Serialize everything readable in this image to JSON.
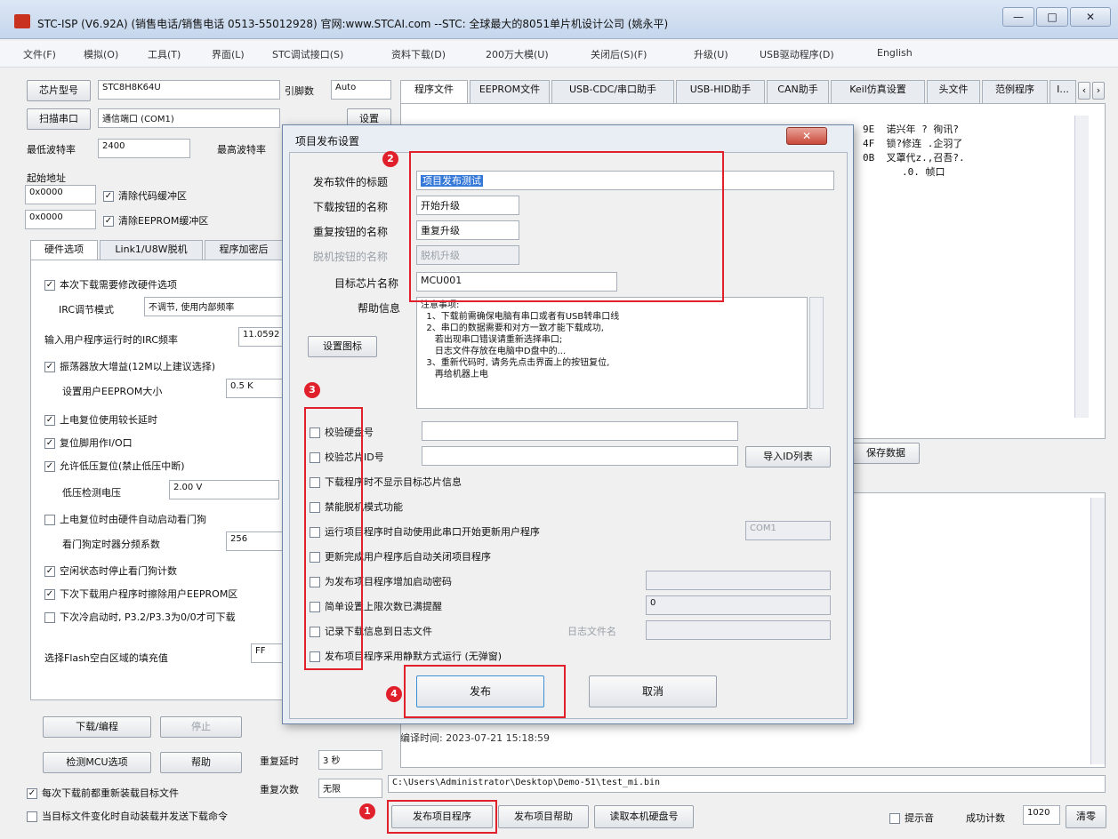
{
  "window": {
    "title": "STC-ISP (V6.92A) (销售电话/销售电话 0513-55012928) 官网:www.STCAI.com  --STC: 全球最大的8051单片机设计公司 (姚永平)",
    "min": "—",
    "max": "□",
    "close": "✕"
  },
  "menu": [
    "文件(F)",
    "模拟(O)",
    "工具(T)",
    "界面(L)",
    "STC调试接口(S)",
    "资料下载(D)",
    "200万大模(U)",
    "关闭后(S)(F)",
    "升级(U)",
    "USB驱动程序(D)",
    "English"
  ],
  "left": {
    "chip_label": "芯片型号",
    "chip_value": "STC8H8K64U",
    "pins_label": "引脚数",
    "pins_value": "Auto",
    "scan_btn": "扫描串口",
    "port_value": "通信端口 (COM1)",
    "settings_btn": "设置",
    "min_baud_label": "最低波特率",
    "min_baud_value": "2400",
    "max_baud_label": "最高波特率",
    "start_addr_label": "起始地址",
    "addr1": "0x0000",
    "clear_code": "清除代码缓冲区",
    "addr2": "0x0000",
    "clear_eeprom": "清除EEPROM缓冲区",
    "tabs": [
      "硬件选项",
      "Link1/U8W脱机",
      "程序加密后"
    ],
    "opts": {
      "o1": "本次下载需要修改硬件选项",
      "irc_label": "IRC调节模式",
      "irc_value": "不调节, 使用内部频率",
      "freq_label": "输入用户程序运行时的IRC频率",
      "freq_value": "11.0592",
      "o2": "振荡器放大增益(12M以上建议选择)",
      "eeprom_size_label": "设置用户EEPROM大小",
      "eeprom_size_value": "0.5 K",
      "o3": "上电复位使用较长延时",
      "o4": "复位脚用作I/O口",
      "o5": "允许低压复位(禁止低压中断)",
      "lv_label": "低压检测电压",
      "lv_value": "2.00 V",
      "o6": "上电复位时由硬件自动启动看门狗",
      "wdt_label": "看门狗定时器分频系数",
      "wdt_value": "256",
      "o7": "空闲状态时停止看门狗计数",
      "o8": "下次下载用户程序时擦除用户EEPROM区",
      "o9": "下次冷启动时, P3.2/P3.3为0/0才可下载",
      "fill_label": "选择Flash空白区域的填充值",
      "fill_value": "FF"
    },
    "download_btn": "下载/编程",
    "stop_btn": "停止",
    "check_mcu_btn": "检测MCU选项",
    "help_btn": "帮助",
    "retry_delay_label": "重复延时",
    "retry_delay_value": "3 秒",
    "retry_count_label": "重复次数",
    "retry_count_value": "无限",
    "reload_each": "每次下载前都重新装载目标文件",
    "auto_send": "当目标文件变化时自动装载并发送下载命令"
  },
  "right": {
    "tabs": [
      "程序文件",
      "EEPROM文件",
      "USB-CDC/串口助手",
      "USB-HID助手",
      "CAN助手",
      "Keil仿真设置",
      "头文件",
      "范例程序",
      "I..."
    ],
    "hex": [
      {
        "addr": "9E",
        "text": "诺兴年 ?  徇讯?"
      },
      {
        "addr": "4F",
        "text": "锁?修连  .企羽了"
      },
      {
        "addr": "0B",
        "text": "叉罩代z.,召吾?."
      },
      {
        "addr": "",
        "text": ".0. 帧口"
      }
    ],
    "save_data_btn": "保存数据",
    "log_line": "编译时间: 2023-07-21 15:18:59",
    "file_path": "C:\\Users\\Administrator\\Desktop\\Demo-51\\test_mi.bin",
    "publish_btn": "发布项目程序",
    "publish_help_btn": "发布项目帮助",
    "read_serial_btn": "读取本机硬盘号",
    "tip_sound": "提示音",
    "success_label": "成功计数",
    "success_value": "1020",
    "clear_btn": "清零"
  },
  "dialog": {
    "title": "项目发布设置",
    "close": "✕",
    "software_title_label": "发布软件的标题",
    "software_title_value": "项目发布测试",
    "download_btn_name_label": "下载按钮的名称",
    "download_btn_name_value": "开始升级",
    "retry_btn_name_label": "重复按钮的名称",
    "retry_btn_name_value": "重复升级",
    "offline_btn_name_label": "脱机按钮的名称",
    "offline_btn_name_value": "脱机升级",
    "target_chip_label": "目标芯片名称",
    "target_chip_value": "MCU001",
    "help_info_label": "帮助信息",
    "help_text": "注意事项:\n  1、下载前需确保电脑有串口或者有USB转串口线\n  2、串口的数据需要和对方一致才能下载成功,\n     若出现串口错误请重新选择串口;\n     日志文件存放在电脑中D盘中的...\n  3、重新代码时, 请务先点击界面上的按钮复位,\n     再给机器上电",
    "set_icon_btn": "设置图标",
    "opts": [
      "校验硬盘号",
      "校验芯片ID号",
      "下载程序时不显示目标芯片信息",
      "禁能脱机模式功能",
      "运行项目程序时自动使用此串口开始更新用户程序",
      "更新完成用户程序后自动关闭项目程序",
      "为发布项目程序增加启动密码",
      "简单设置上限次数已满提醒",
      "记录下载信息到日志文件",
      "发布项目程序采用静默方式运行 (无弹窗)"
    ],
    "import_id_btn": "导入ID列表",
    "com_value": "COM1",
    "count_value": "0",
    "log_file_label": "日志文件名",
    "publish_btn": "发布",
    "cancel_btn": "取消",
    "badges": [
      "1",
      "2",
      "3",
      "4"
    ]
  },
  "colors": {
    "highlight": "#e0202a",
    "titlebar": "#c5d6ec"
  }
}
